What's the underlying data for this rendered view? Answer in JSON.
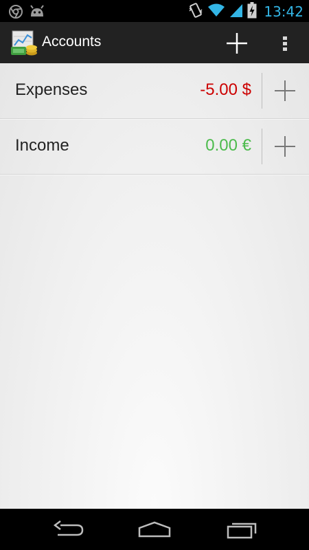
{
  "status_bar": {
    "time": "13:42",
    "left_icons": [
      "chrome-icon",
      "android-debug-icon"
    ],
    "right_icons": [
      "vibrate-icon",
      "wifi-icon",
      "signal-icon",
      "battery-charging-icon"
    ],
    "time_color": "#33b5e5"
  },
  "action_bar": {
    "title": "Accounts",
    "add_icon": "plus-icon",
    "overflow_icon": "overflow-menu-icon"
  },
  "accounts": [
    {
      "name": "Expenses",
      "amount": "-5.00 $",
      "color": "#cc0000"
    },
    {
      "name": "Income",
      "amount": "0.00 €",
      "color": "#4cbb4c"
    }
  ],
  "nav_bar": {
    "buttons": [
      "back-icon",
      "home-icon",
      "recent-apps-icon"
    ]
  }
}
